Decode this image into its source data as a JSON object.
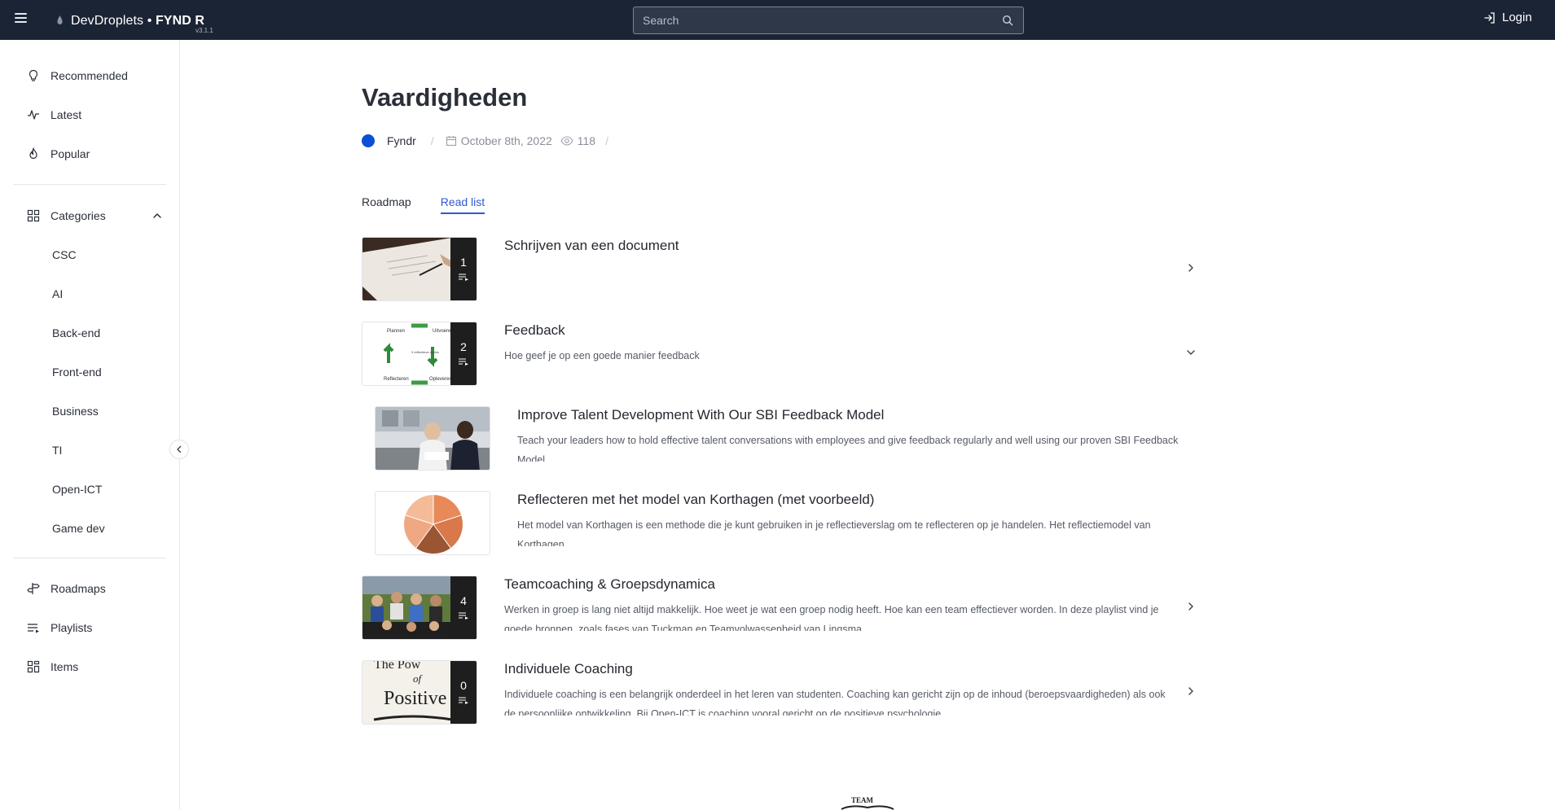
{
  "header": {
    "brand_name": "DevDroplets",
    "brand_separator": "•",
    "brand_product": "FYND R",
    "version": "v3.1.1",
    "search_placeholder": "Search",
    "login_label": "Login",
    "background": "#1b2435"
  },
  "sidebar": {
    "top_items": [
      {
        "label": "Recommended",
        "icon": "lightbulb-icon"
      },
      {
        "label": "Latest",
        "icon": "trend-line-icon"
      },
      {
        "label": "Popular",
        "icon": "flame-icon"
      }
    ],
    "categories_label": "Categories",
    "categories": [
      "CSC",
      "AI",
      "Back-end",
      "Front-end",
      "Business",
      "TI",
      "Open-ICT",
      "Game dev"
    ],
    "bottom_items": [
      {
        "label": "Roadmaps",
        "icon": "signpost-icon"
      },
      {
        "label": "Playlists",
        "icon": "playlist-icon"
      },
      {
        "label": "Items",
        "icon": "grid-icon"
      }
    ]
  },
  "page": {
    "title": "Vaardigheden",
    "author": "Fyndr",
    "date": "October 8th, 2022",
    "views": "118",
    "accent": "#2c5ad6",
    "avatar_color": "#0b4fd6"
  },
  "tabs": [
    {
      "label": "Roadmap",
      "active": false
    },
    {
      "label": "Read list",
      "active": true
    }
  ],
  "read_list": [
    {
      "title": "Schrijven van een document",
      "description": "",
      "count": "1",
      "expanded": false
    },
    {
      "title": "Feedback",
      "description": "Hoe geef je op een goede manier feedback",
      "count": "2",
      "expanded": true
    },
    {
      "title": "Teamcoaching & Groepsdynamica",
      "description": "Werken in groep is lang niet altijd makkelijk. Hoe weet je wat een groep nodig heeft. Hoe kan een team effectiever worden. In deze playlist vind je goede bronnen, zoals fases van Tuckman en Teamvolwassenheid van Lingsma",
      "count": "4",
      "expanded": false
    },
    {
      "title": "Individuele Coaching",
      "description": "Individuele coaching is een belangrijk onderdeel in het leren van studenten. Coaching kan gericht zijn op de inhoud (beroepsvaardigheden) als ook de persoonlijke ontwikkeling. Bij Open-ICT is coaching vooral gericht op de positieve psychologie.",
      "count": "0",
      "expanded": false
    }
  ],
  "feedback_items": [
    {
      "title": "Improve Talent Development With Our SBI Feedback Model",
      "description": "Teach your leaders how to hold effective talent conversations with employees and give feedback regularly and well using our proven SBI Feedback Model."
    },
    {
      "title": "Reflecteren met het model van Korthagen (met voorbeeld)",
      "description": "Het model van Korthagen is een methode die je kunt gebruiken in je reflectieverslag om te reflecteren op je handelen. Het reflectiemodel van Korthagen"
    }
  ],
  "thumb_labels": {
    "cycle": [
      "Plannen",
      "Uitvoeren",
      "Reflecteren",
      "Opleveren",
      "3 reflectieve cycles"
    ],
    "coaching": [
      "The Pow",
      "of",
      "Positive"
    ],
    "footer_stub": "TEAM"
  }
}
